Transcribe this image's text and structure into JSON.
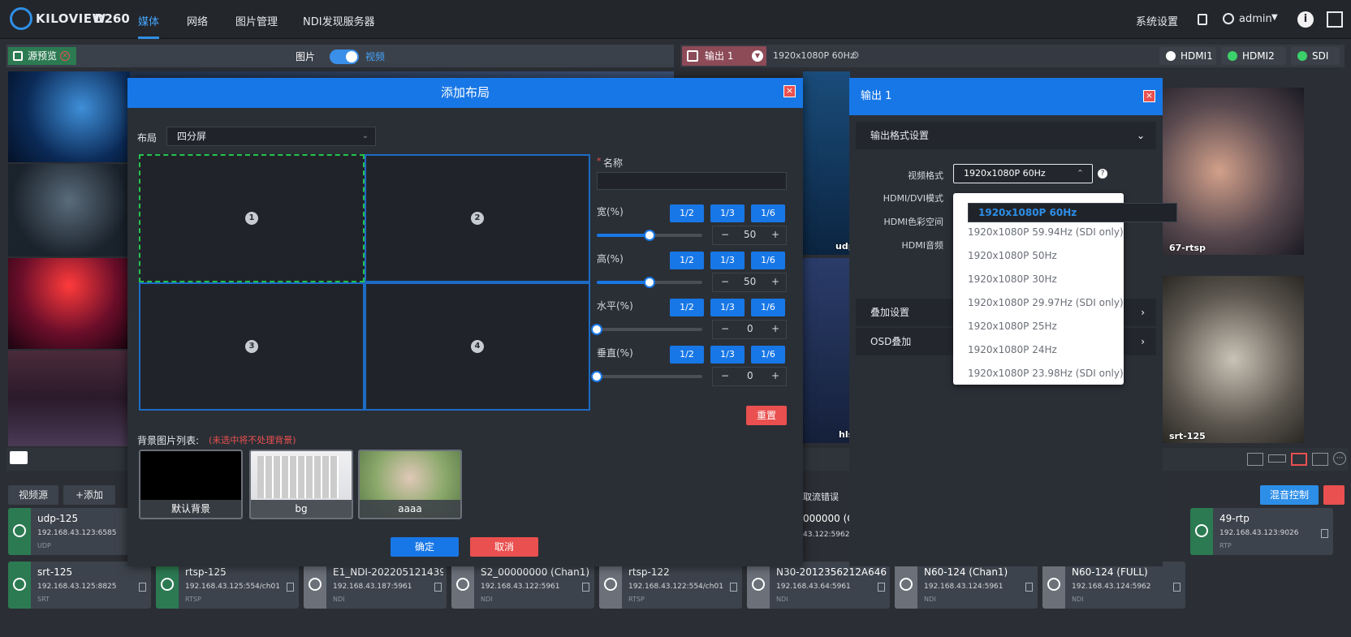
{
  "brand": {
    "logo": "KILOVIEW",
    "model": "D260"
  },
  "nav": {
    "items": [
      "媒体",
      "网络",
      "图片管理",
      "NDI发现服务器"
    ],
    "active": "媒体"
  },
  "header": {
    "settings": "系统设置",
    "user": "admin",
    "info": "i"
  },
  "source_preview": {
    "tag": "源预览",
    "mode_image": "图片",
    "mode_video": "视频"
  },
  "output_bar": {
    "name": "输出 1",
    "format": "1920x1080P 60Hz",
    "outputs": [
      "HDMI1",
      "HDMI2",
      "SDI"
    ]
  },
  "tiles": {
    "udp": "udp",
    "rtsp67": "67-rtsp",
    "hls": "hls",
    "srt125": "srt-125"
  },
  "toolbar": {
    "sources": "视频源",
    "add": "+添加",
    "cancel_err": "取流错误",
    "mix": "混音控制"
  },
  "sources": [
    {
      "name": "udp-125",
      "addr": "192.168.43.123:6585",
      "proto": "UDP"
    },
    {
      "name": "srt-125",
      "addr": "192.168.43.125:8825",
      "proto": "SRT"
    },
    {
      "name": "rtsp-125",
      "addr": "192.168.43.125:554/ch01",
      "proto": "RTSP"
    },
    {
      "name": "E1_NDI-202205121439...",
      "addr": "192.168.43.187:5961",
      "proto": "NDI"
    },
    {
      "name": "S2_00000000 (Chan1)",
      "addr": "192.168.43.122:5961",
      "proto": "NDI"
    },
    {
      "name": "rtsp-122",
      "addr": "192.168.43.122:554/ch01",
      "proto": "RTSP"
    },
    {
      "name": "N30-2012356212A6466...",
      "addr": "192.168.43.64:5961",
      "proto": "NDI"
    },
    {
      "name": "N60-124 (Chan1)",
      "addr": "192.168.43.124:5961",
      "proto": "NDI"
    },
    {
      "name": "N60-124 (FULL)",
      "addr": "192.168.43.124:5962",
      "proto": "NDI"
    },
    {
      "name": "49-rtp",
      "addr": "192.168.43.123:9026",
      "proto": "RTP"
    },
    {
      "name": "000000 (Ch",
      "addr": "43.122:5962",
      "proto": ""
    }
  ],
  "modal": {
    "title": "添加布局",
    "layout_label": "布局",
    "layout_value": "四分屏",
    "cells": [
      "1",
      "2",
      "3",
      "4"
    ],
    "name_label": "名称",
    "required_mark": "*",
    "width_label": "宽(%)",
    "width_value": "50",
    "height_label": "高(%)",
    "height_value": "50",
    "h_label": "水平(%)",
    "h_value": "0",
    "v_label": "垂直(%)",
    "v_value": "0",
    "width_fill": 0.5,
    "height_fill": 0.5,
    "h_fill": 0,
    "v_fill": 0,
    "fractions": [
      "1/2",
      "1/3",
      "1/6"
    ],
    "reset": "重置",
    "bg_title": "背景图片列表:",
    "bg_note": "(未选中将不处理背景)",
    "bg_items": [
      "默认背景",
      "bg",
      "aaaa"
    ],
    "ok": "确定",
    "cancel": "取消"
  },
  "out_panel": {
    "title": "输出 1",
    "section": "输出格式设置",
    "video_format_label": "视频格式",
    "video_format_value": "1920x1080P 60Hz",
    "hdmi_dvi": "HDMI/DVI模式",
    "hdmi_color": "HDMI色彩空间",
    "hdmi_audio": "HDMI音频",
    "overlay": "叠加设置",
    "osd": "OSD叠加",
    "options": [
      "1920x1080P 60Hz",
      "1920x1080P 59.94Hz (SDI only)",
      "1920x1080P 50Hz",
      "1920x1080P 30Hz",
      "1920x1080P 29.97Hz (SDI only)",
      "1920x1080P 25Hz",
      "1920x1080P 24Hz",
      "1920x1080P 23.98Hz (SDI only)"
    ]
  },
  "colors": {
    "accent": "#1877e6",
    "green": "#2c7a52",
    "red": "#e9504f"
  }
}
